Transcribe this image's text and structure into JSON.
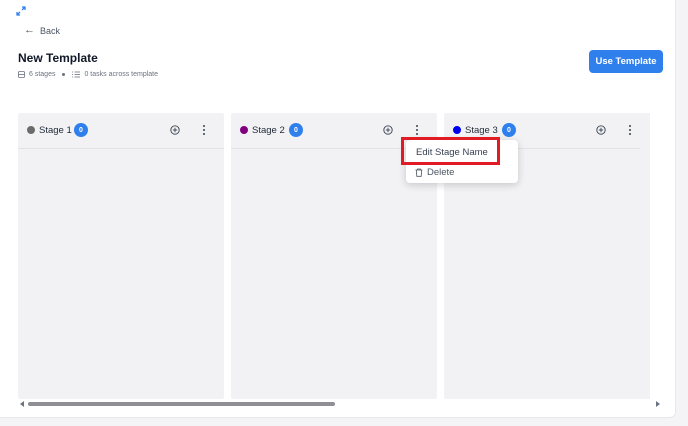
{
  "nav": {
    "back_label": "Back"
  },
  "page": {
    "title": "New Template",
    "stages_count_text": "6 stages",
    "tasks_text": "0 tasks across template"
  },
  "actions": {
    "use_template_label": "Use Template"
  },
  "stages": [
    {
      "name": "Stage 1",
      "count": "0",
      "color": "#6b6b6b"
    },
    {
      "name": "Stage 2",
      "count": "0",
      "color": "#800080"
    },
    {
      "name": "Stage 3",
      "count": "0",
      "color": "#0000ee"
    }
  ],
  "stage_menu": {
    "items": [
      {
        "label": "Edit Stage Name",
        "icon": ""
      },
      {
        "label": "Delete",
        "icon": "trash-icon"
      }
    ]
  },
  "colors": {
    "accent": "#2f80ed",
    "highlight": "#e01b24",
    "column_bg": "#f2f2f4"
  }
}
